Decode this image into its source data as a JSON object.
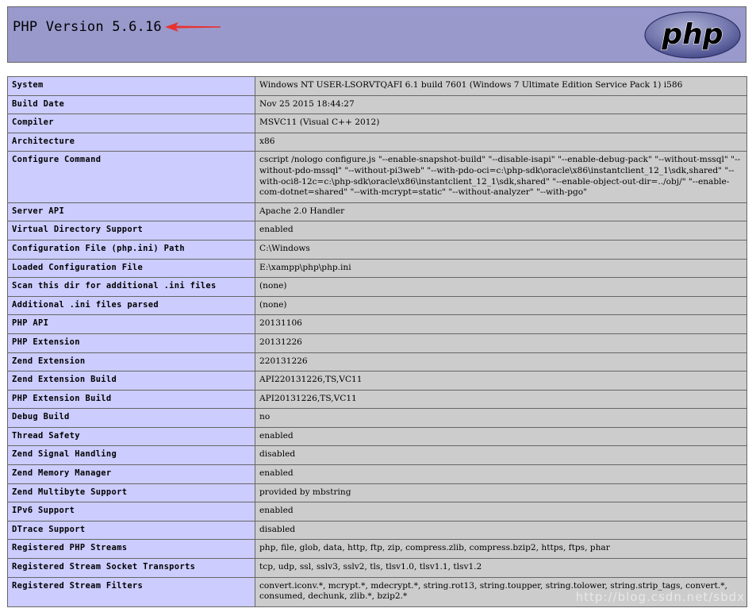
{
  "header": {
    "title": "PHP Version 5.6.16",
    "logo_text": "php"
  },
  "rows": [
    {
      "label": "System",
      "value": "Windows NT USER-LSORVTQAFI 6.1 build 7601 (Windows 7 Ultimate Edition Service Pack 1) i586"
    },
    {
      "label": "Build Date",
      "value": "Nov 25 2015 18:44:27"
    },
    {
      "label": "Compiler",
      "value": "MSVC11 (Visual C++ 2012)"
    },
    {
      "label": "Architecture",
      "value": "x86"
    },
    {
      "label": "Configure Command",
      "value": "cscript /nologo configure.js \"--enable-snapshot-build\" \"--disable-isapi\" \"--enable-debug-pack\" \"--without-mssql\" \"--without-pdo-mssql\" \"--without-pi3web\" \"--with-pdo-oci=c:\\php-sdk\\oracle\\x86\\instantclient_12_1\\sdk,shared\" \"--with-oci8-12c=c:\\php-sdk\\oracle\\x86\\instantclient_12_1\\sdk,shared\" \"--enable-object-out-dir=../obj/\" \"--enable-com-dotnet=shared\" \"--with-mcrypt=static\" \"--without-analyzer\" \"--with-pgo\""
    },
    {
      "label": "Server API",
      "value": "Apache 2.0 Handler"
    },
    {
      "label": "Virtual Directory Support",
      "value": "enabled"
    },
    {
      "label": "Configuration File (php.ini) Path",
      "value": "C:\\Windows"
    },
    {
      "label": "Loaded Configuration File",
      "value": "E:\\xampp\\php\\php.ini"
    },
    {
      "label": "Scan this dir for additional .ini files",
      "value": "(none)"
    },
    {
      "label": "Additional .ini files parsed",
      "value": "(none)"
    },
    {
      "label": "PHP API",
      "value": "20131106"
    },
    {
      "label": "PHP Extension",
      "value": "20131226"
    },
    {
      "label": "Zend Extension",
      "value": "220131226"
    },
    {
      "label": "Zend Extension Build",
      "value": "API220131226,TS,VC11"
    },
    {
      "label": "PHP Extension Build",
      "value": "API20131226,TS,VC11"
    },
    {
      "label": "Debug Build",
      "value": "no"
    },
    {
      "label": "Thread Safety",
      "value": "enabled"
    },
    {
      "label": "Zend Signal Handling",
      "value": "disabled"
    },
    {
      "label": "Zend Memory Manager",
      "value": "enabled"
    },
    {
      "label": "Zend Multibyte Support",
      "value": "provided by mbstring"
    },
    {
      "label": "IPv6 Support",
      "value": "enabled"
    },
    {
      "label": "DTrace Support",
      "value": "disabled"
    },
    {
      "label": "Registered PHP Streams",
      "value": "php, file, glob, data, http, ftp, zip, compress.zlib, compress.bzip2, https, ftps, phar"
    },
    {
      "label": "Registered Stream Socket Transports",
      "value": "tcp, udp, ssl, sslv3, sslv2, tls, tlsv1.0, tlsv1.1, tlsv1.2"
    },
    {
      "label": "Registered Stream Filters",
      "value": "convert.iconv.*, mcrypt.*, mdecrypt.*, string.rot13, string.toupper, string.tolower, string.strip_tags, convert.*, consumed, dechunk, zlib.*, bzip2.*"
    }
  ],
  "watermark": "http://blog.csdn.net/sbdx",
  "colors": {
    "header_bg": "#9999cc",
    "label_bg": "#ccccff",
    "value_bg": "#cccccc",
    "annotation_arrow": "#e8322f"
  }
}
